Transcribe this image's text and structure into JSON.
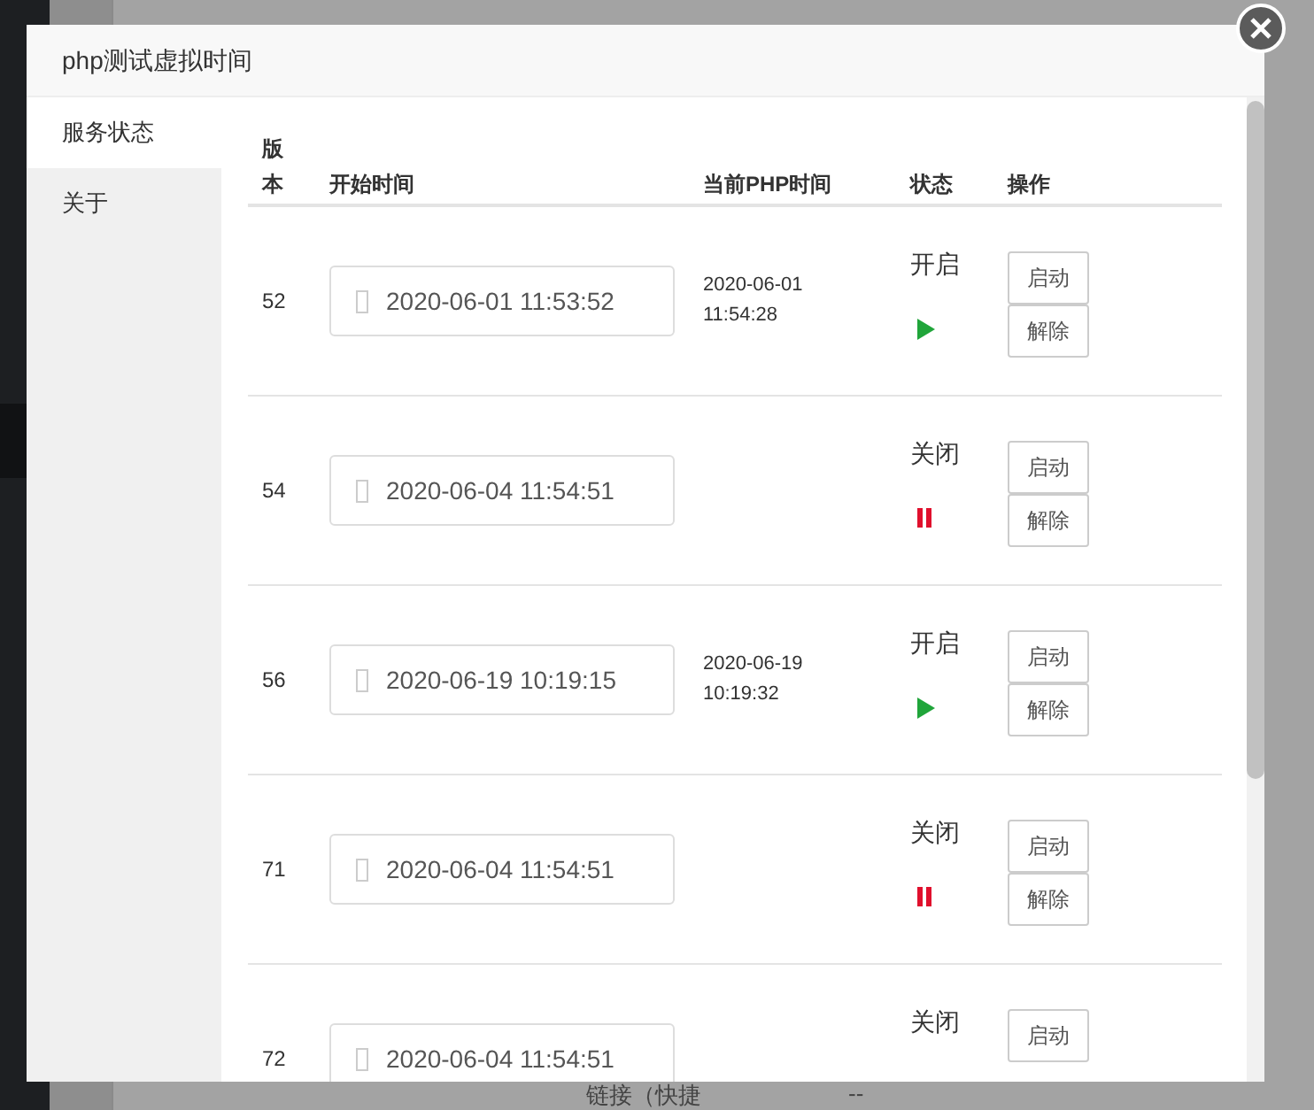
{
  "background": {
    "bottom_row": [
      "链接（快捷",
      "--"
    ]
  },
  "dialog": {
    "title": "php测试虚拟时间"
  },
  "sidebar": {
    "items": [
      {
        "label": "服务状态",
        "selected": true
      },
      {
        "label": "关于",
        "selected": false
      }
    ]
  },
  "table": {
    "columns": [
      "版本",
      "开始时间",
      "当前PHP时间",
      "状态",
      "操作"
    ],
    "rows": [
      {
        "version": "52",
        "start_time": "2020-06-01 11:53:52",
        "php_time": "2020-06-01 11:54:28",
        "status": "开启",
        "running": true,
        "actions": [
          "启动",
          "解除"
        ]
      },
      {
        "version": "54",
        "start_time": "2020-06-04 11:54:51",
        "status": "关闭",
        "running": false,
        "actions": [
          "启动",
          "解除"
        ]
      },
      {
        "version": "56",
        "start_time": "2020-06-19 10:19:15",
        "php_time": "2020-06-19 10:19:32",
        "status": "开启",
        "running": true,
        "actions": [
          "启动",
          "解除"
        ]
      },
      {
        "version": "71",
        "start_time": "2020-06-04 11:54:51",
        "status": "关闭",
        "running": false,
        "actions": [
          "启动",
          "解除"
        ]
      },
      {
        "version": "72",
        "start_time": "2020-06-04 11:54:51",
        "status": "关闭",
        "actions": [
          "启动"
        ]
      }
    ]
  }
}
